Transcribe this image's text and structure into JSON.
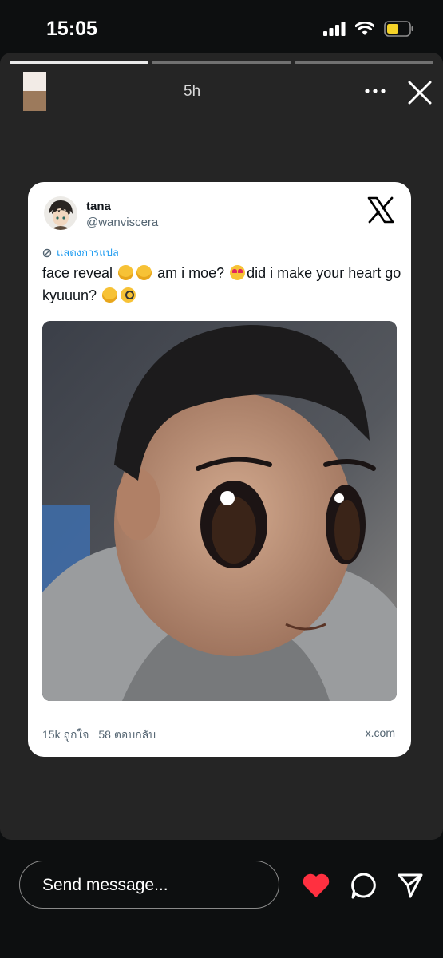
{
  "status_bar": {
    "time": "15:05"
  },
  "story": {
    "elapsed": "5h",
    "progress_segments": 3,
    "active_segment": 1
  },
  "tweet": {
    "display_name": "tana",
    "handle": "@wanviscera",
    "translate_label": "แสดงการแปล",
    "text_part1": "face reveal",
    "text_part2": "am i moe?",
    "text_part3": "did i make your heart go kyuuun?",
    "likes": "15k ถูกใจ",
    "replies": "58 ตอบกลับ",
    "domain": "x.com"
  },
  "footer": {
    "message_placeholder": "Send message...",
    "like_color": "#ff3040"
  },
  "icons": {
    "signal": "signal-icon",
    "wifi": "wifi-icon",
    "battery": "battery-icon",
    "more": "more-icon",
    "close": "close-icon",
    "x_logo": "x-logo-icon",
    "translate": "translate-icon",
    "heart": "heart-icon",
    "reply": "reply-icon",
    "share": "send-icon"
  }
}
